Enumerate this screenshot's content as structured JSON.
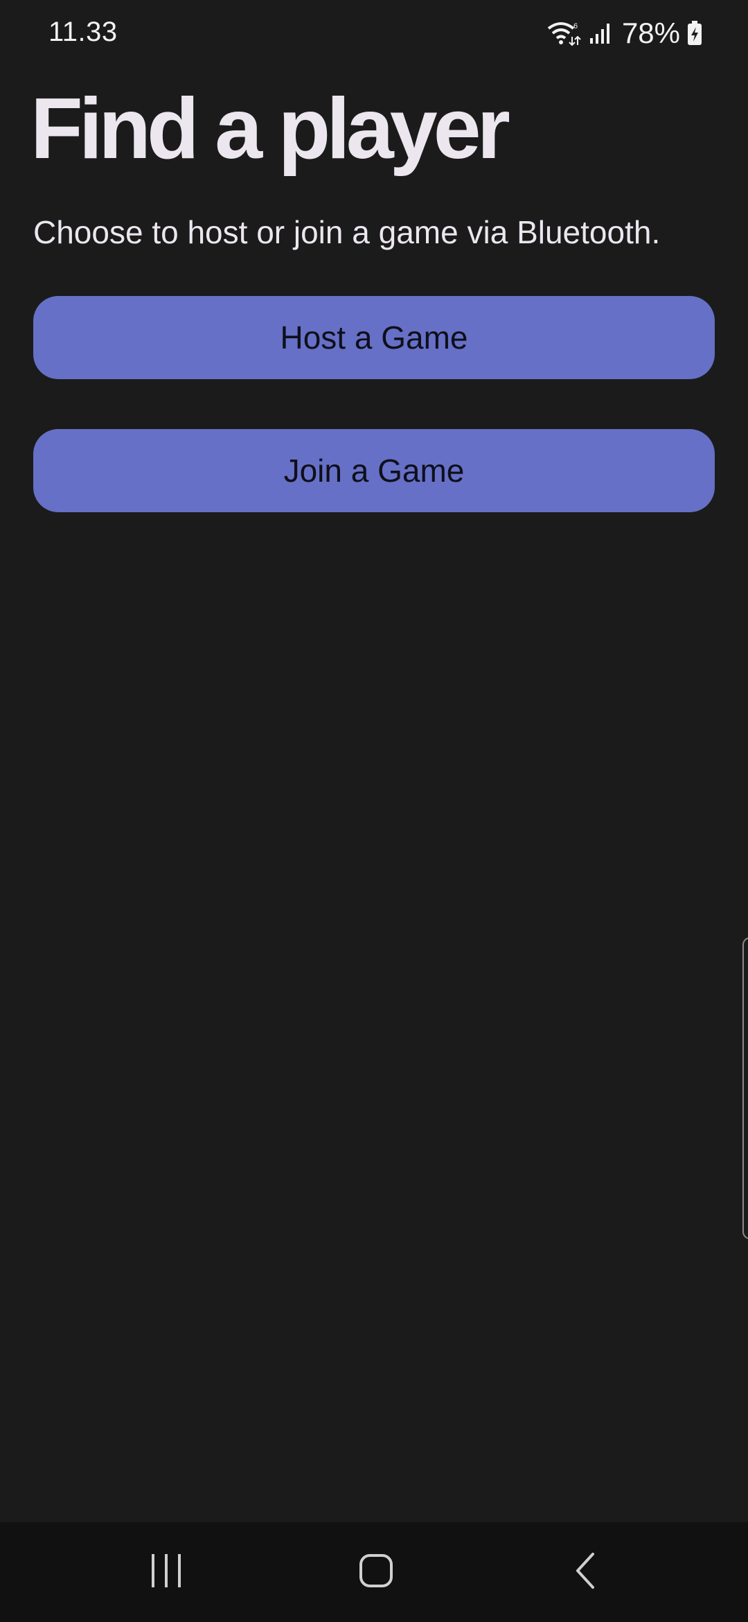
{
  "status_bar": {
    "time": "11.33",
    "battery_percent": "78%",
    "icons": [
      "wifi-icon",
      "signal-icon",
      "battery-charging-icon"
    ]
  },
  "page": {
    "title": "Find a player",
    "subtitle": "Choose to host or join a game via Bluetooth."
  },
  "actions": {
    "host_label": "Host a Game",
    "join_label": "Join a Game"
  },
  "nav_bar": {
    "icons": [
      "recents-icon",
      "home-icon",
      "back-icon"
    ]
  },
  "colors": {
    "background": "#1b1b1c",
    "button": "#6670c6",
    "button_text": "#0e0f1a",
    "text": "#ece6ee",
    "nav_background": "#111112"
  }
}
